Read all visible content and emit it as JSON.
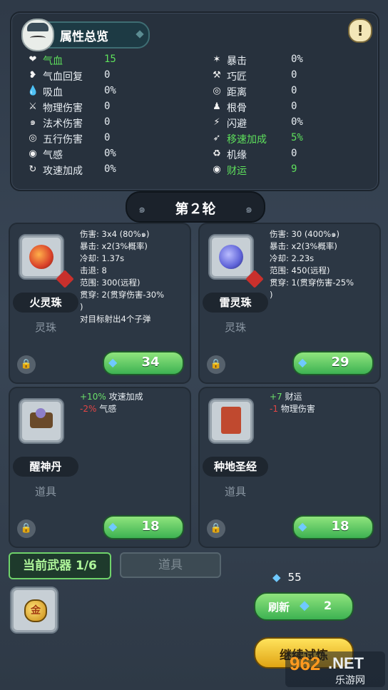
{
  "stats_panel": {
    "title": "属性总览",
    "help_icon": "!",
    "left": [
      {
        "icon": "heart-icon",
        "glyph": "❤",
        "label": "气血",
        "value": "15",
        "highlight": true
      },
      {
        "icon": "heart-regen-icon",
        "glyph": "❥",
        "label": "气血回复",
        "value": "0",
        "highlight": false
      },
      {
        "icon": "blood-drop-icon",
        "glyph": "💧",
        "label": "吸血",
        "value": "0%",
        "highlight": false
      },
      {
        "icon": "sword-icon",
        "glyph": "⚔",
        "label": "物理伤害",
        "value": "0",
        "highlight": false
      },
      {
        "icon": "swirl-icon",
        "glyph": "๑",
        "label": "法术伤害",
        "value": "0",
        "highlight": false
      },
      {
        "icon": "five-elements-icon",
        "glyph": "◎",
        "label": "五行伤害",
        "value": "0",
        "highlight": false
      },
      {
        "icon": "qi-sense-icon",
        "glyph": "◉",
        "label": "气感",
        "value": "0%",
        "highlight": false
      },
      {
        "icon": "attack-speed-icon",
        "glyph": "↻",
        "label": "攻速加成",
        "value": "0%",
        "highlight": false
      }
    ],
    "right": [
      {
        "icon": "crit-claw-icon",
        "glyph": "✶",
        "label": "暴击",
        "value": "0%",
        "highlight": false
      },
      {
        "icon": "hammer-icon",
        "glyph": "⚒",
        "label": "巧匠",
        "value": "0",
        "highlight": false
      },
      {
        "icon": "range-target-icon",
        "glyph": "◎",
        "label": "距离",
        "value": "0",
        "highlight": false
      },
      {
        "icon": "bone-figure-icon",
        "glyph": "♟",
        "label": "根骨",
        "value": "0",
        "highlight": false
      },
      {
        "icon": "dodge-figure-icon",
        "glyph": "⚡",
        "label": "闪避",
        "value": "0%",
        "highlight": false
      },
      {
        "icon": "running-icon",
        "glyph": "➶",
        "label": "移速加成",
        "value": "5%",
        "highlight": true
      },
      {
        "icon": "fate-cycle-icon",
        "glyph": "♻",
        "label": "机缘",
        "value": "0",
        "highlight": false
      },
      {
        "icon": "fortune-coin-icon",
        "glyph": "◉",
        "label": "财运",
        "value": "9",
        "highlight": true
      }
    ]
  },
  "round": {
    "label": "第２轮"
  },
  "cards": [
    {
      "name": "火灵珠",
      "kind": "灵珠",
      "price": "34",
      "orb_color": "#d9412a",
      "desc": [
        "伤害: 3x4 (80%๑)",
        "暴击: x2(3%概率)",
        "冷却: 1.37s",
        "击退: 8",
        "范围: 300(远程)",
        "贯穿: 2(贯穿伤害-30%",
        ")",
        "对目标射出4个子弹"
      ]
    },
    {
      "name": "雷灵珠",
      "kind": "灵珠",
      "price": "29",
      "orb_color": "#5f63d8",
      "desc": [
        "伤害: 30 (400%๑)",
        "暴击: x2(3%概率)",
        "冷却: 2.23s",
        "范围: 450(远程)",
        "贯穿: 1(贯穿伤害-25%",
        ")"
      ]
    },
    {
      "name": "醒神丹",
      "kind": "道具",
      "price": "18",
      "effects": [
        {
          "amount": "+10%",
          "text": "攻速加成",
          "sign": "up"
        },
        {
          "amount": "-2%",
          "text": "气感",
          "sign": "down"
        }
      ]
    },
    {
      "name": "种地圣经",
      "kind": "道具",
      "price": "18",
      "effects": [
        {
          "amount": "+7",
          "text": "财运",
          "sign": "up"
        },
        {
          "amount": "-1",
          "text": "物理伤害",
          "sign": "down"
        }
      ]
    }
  ],
  "bottom": {
    "current_weapon_tab": "当前武器 1/6",
    "items_tab": "道具",
    "weapon_glyph": "金",
    "gems": "55",
    "refresh_label": "刷新",
    "refresh_cost": "2",
    "continue_label": "继续试炼"
  },
  "watermark": {
    "brand": "962",
    "net": ".NET",
    "site": "乐游网"
  }
}
